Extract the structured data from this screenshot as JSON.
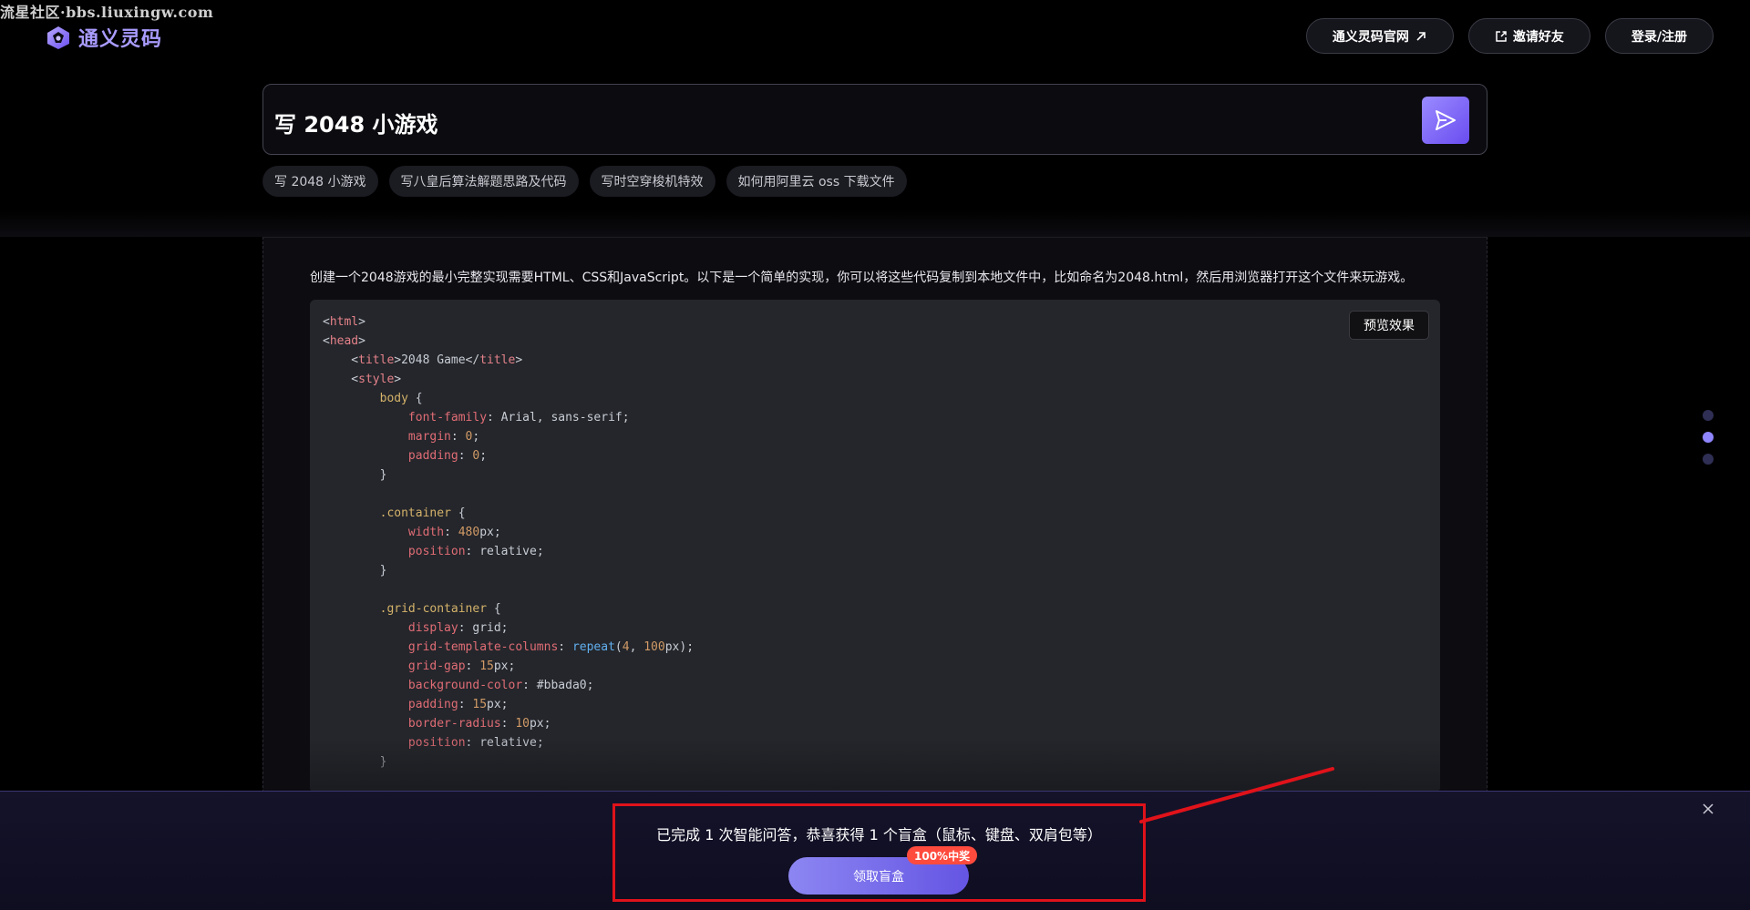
{
  "watermark": "流星社区·bbs.liuxingw.com",
  "header": {
    "logo_text": "通义灵码",
    "buttons": [
      {
        "label": "通义灵码官网"
      },
      {
        "label": "邀请好友"
      },
      {
        "label": "登录/注册"
      }
    ]
  },
  "search": {
    "query": "写 2048 小游戏",
    "submit_icon": "send-icon"
  },
  "suggestions": [
    "写 2048 小游戏",
    "写八皇后算法解题思路及代码",
    "写时空穿梭机特效",
    "如何用阿里云 oss 下载文件"
  ],
  "answer": {
    "intro": "创建一个2048游戏的最小完整实现需要HTML、CSS和JavaScript。以下是一个简单的实现，你可以将这些代码复制到本地文件中，比如命名为2048.html，然后用浏览器打开这个文件来玩游戏。",
    "preview_button": "预览效果",
    "code_lines": [
      "<html>",
      "<head>",
      "    <title>2048 Game</title>",
      "    <style>",
      "        body {",
      "            font-family: Arial, sans-serif;",
      "            margin: 0;",
      "            padding: 0;",
      "        }",
      "",
      "        .container {",
      "            width: 480px;",
      "            position: relative;",
      "        }",
      "",
      "        .grid-container {",
      "            display: grid;",
      "            grid-template-columns: repeat(4, 100px);",
      "            grid-gap: 15px;",
      "            background-color: #bbada0;",
      "            padding: 15px;",
      "            border-radius: 10px;",
      "            position: relative;",
      "        }"
    ]
  },
  "pagination": {
    "count": 3,
    "active_index": 1
  },
  "promo": {
    "message": "已完成 1 次智能问答，恭喜获得 1 个盲盒（鼠标、键盘、双肩包等）",
    "button_label": "领取盲盒",
    "badge": "100%中奖"
  },
  "colors": {
    "accent": "#7b6cf6",
    "highlight_border": "#e0121a",
    "badge": "#ff4b3e"
  }
}
